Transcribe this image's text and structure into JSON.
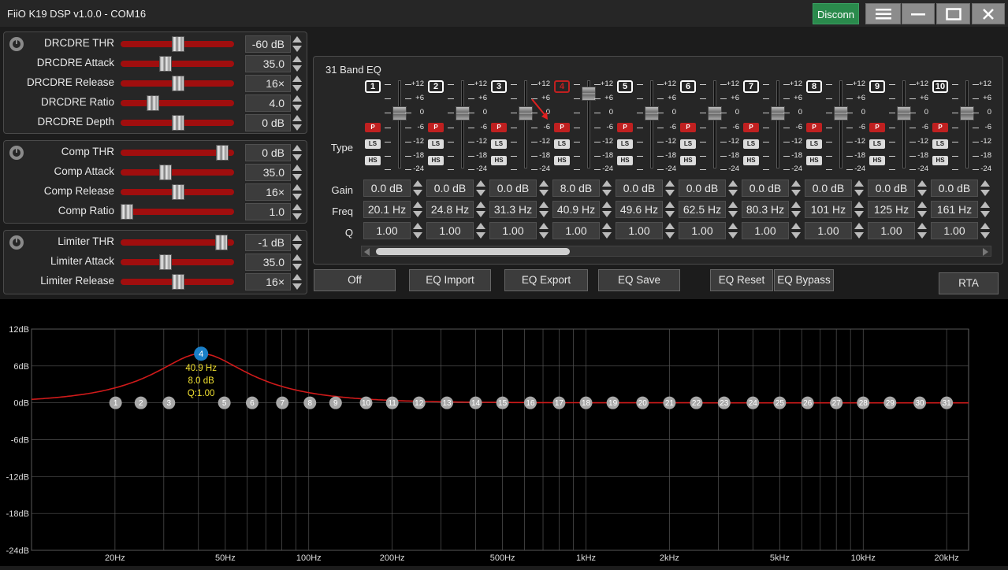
{
  "window": {
    "title": "FiiO K19 DSP v1.0.0 - COM16",
    "disconnect_label": "Disconn",
    "menu_icon": "hamburger-icon",
    "minimize_icon": "minimize-icon",
    "maximize_icon": "maximize-icon",
    "close_icon": "close-icon"
  },
  "drc": {
    "rows": [
      {
        "label": "DRCDRE THR",
        "value": "-60 dB",
        "pos": 0.5
      },
      {
        "label": "DRCDRE Attack",
        "value": "35.0 ms",
        "pos": 0.38
      },
      {
        "label": "DRCDRE Release",
        "value": "16×",
        "pos": 0.5
      },
      {
        "label": "DRCDRE Ratio",
        "value": "4.0",
        "pos": 0.25
      },
      {
        "label": "DRCDRE Depth",
        "value": "0 dB",
        "pos": 0.5
      }
    ]
  },
  "comp": {
    "rows": [
      {
        "label": "Comp THR",
        "value": "0 dB",
        "pos": 0.93
      },
      {
        "label": "Comp Attack",
        "value": "35.0 ms",
        "pos": 0.38
      },
      {
        "label": "Comp Release",
        "value": "16×",
        "pos": 0.5
      },
      {
        "label": "Comp Ratio",
        "value": "1.0",
        "pos": 0.0
      }
    ]
  },
  "limiter": {
    "rows": [
      {
        "label": "Limiter THR",
        "value": "-1 dB",
        "pos": 0.92
      },
      {
        "label": "Limiter Attack",
        "value": "35.0 ms",
        "pos": 0.38
      },
      {
        "label": "Limiter Release",
        "value": "16×",
        "pos": 0.5
      }
    ]
  },
  "eq": {
    "title": "31 Band EQ",
    "type_label": "Type",
    "gain_label": "Gain",
    "freq_label": "Freq",
    "q_label": "Q",
    "scale": [
      "+12",
      "+6",
      "0",
      "-6",
      "-12",
      "-18",
      "-24"
    ],
    "type_buttons": [
      "P",
      "LS",
      "HS"
    ],
    "bands": [
      {
        "num": "1",
        "gain": "0.0 dB",
        "freq": "20.1 Hz",
        "q": "1.00",
        "level": 0
      },
      {
        "num": "2",
        "gain": "0.0 dB",
        "freq": "24.8 Hz",
        "q": "1.00",
        "level": 0
      },
      {
        "num": "3",
        "gain": "0.0 dB",
        "freq": "31.3 Hz",
        "q": "1.00",
        "level": 0
      },
      {
        "num": "4",
        "gain": "8.0 dB",
        "freq": "40.9 Hz",
        "q": "1.00",
        "level": 8
      },
      {
        "num": "5",
        "gain": "0.0 dB",
        "freq": "49.6 Hz",
        "q": "1.00",
        "level": 0
      },
      {
        "num": "6",
        "gain": "0.0 dB",
        "freq": "62.5 Hz",
        "q": "1.00",
        "level": 0
      },
      {
        "num": "7",
        "gain": "0.0 dB",
        "freq": "80.3 Hz",
        "q": "1.00",
        "level": 0
      },
      {
        "num": "8",
        "gain": "0.0 dB",
        "freq": "101 Hz",
        "q": "1.00",
        "level": 0
      },
      {
        "num": "9",
        "gain": "0.0 dB",
        "freq": "125 Hz",
        "q": "1.00",
        "level": 0
      },
      {
        "num": "10",
        "gain": "0.0 dB",
        "freq": "161 Hz",
        "q": "1.00",
        "level": 0
      }
    ],
    "selected_band": "4"
  },
  "actions": {
    "off": "Off",
    "import": "EQ Import",
    "export": "EQ Export",
    "save": "EQ Save",
    "reset": "EQ Reset",
    "bypass": "EQ Bypass",
    "rta": "RTA"
  },
  "chart_data": {
    "type": "line",
    "y_ticks": [
      "12dB",
      "6dB",
      "0dB",
      "-6dB",
      "-12dB",
      "-18dB",
      "-24dB"
    ],
    "ylim": [
      -24,
      12
    ],
    "x_scale": "log",
    "xlim": [
      10,
      24000
    ],
    "x_ticks": [
      {
        "label": "20Hz",
        "value": 20
      },
      {
        "label": "50Hz",
        "value": 50
      },
      {
        "label": "100Hz",
        "value": 100
      },
      {
        "label": "200Hz",
        "value": 200
      },
      {
        "label": "500Hz",
        "value": 500
      },
      {
        "label": "1kHz",
        "value": 1000
      },
      {
        "label": "2kHz",
        "value": 2000
      },
      {
        "label": "5kHz",
        "value": 5000
      },
      {
        "label": "10kHz",
        "value": 10000
      },
      {
        "label": "20kHz",
        "value": 20000
      }
    ],
    "active_band": {
      "num": "4",
      "freq": 40.9,
      "gain": 8.0,
      "q": 1.0,
      "freq_label": "40.9 Hz",
      "gain_label": "8.0 dB",
      "q_label": "Q:1.00"
    },
    "band_markers": [
      {
        "num": "1",
        "freq": 20.1
      },
      {
        "num": "2",
        "freq": 24.8
      },
      {
        "num": "3",
        "freq": 31.3
      },
      {
        "num": "5",
        "freq": 49.6
      },
      {
        "num": "6",
        "freq": 62.5
      },
      {
        "num": "7",
        "freq": 80.3
      },
      {
        "num": "8",
        "freq": 101
      },
      {
        "num": "9",
        "freq": 125
      },
      {
        "num": "10",
        "freq": 161
      },
      {
        "num": "11",
        "freq": 200
      },
      {
        "num": "12",
        "freq": 250
      },
      {
        "num": "13",
        "freq": 315
      },
      {
        "num": "14",
        "freq": 400
      },
      {
        "num": "15",
        "freq": 500
      },
      {
        "num": "16",
        "freq": 630
      },
      {
        "num": "17",
        "freq": 800
      },
      {
        "num": "18",
        "freq": 1000
      },
      {
        "num": "19",
        "freq": 1250
      },
      {
        "num": "20",
        "freq": 1600
      },
      {
        "num": "21",
        "freq": 2000
      },
      {
        "num": "22",
        "freq": 2500
      },
      {
        "num": "23",
        "freq": 3150
      },
      {
        "num": "24",
        "freq": 4000
      },
      {
        "num": "25",
        "freq": 5000
      },
      {
        "num": "26",
        "freq": 6300
      },
      {
        "num": "27",
        "freq": 8000
      },
      {
        "num": "28",
        "freq": 10000
      },
      {
        "num": "29",
        "freq": 12500
      },
      {
        "num": "30",
        "freq": 16000
      },
      {
        "num": "31",
        "freq": 20000
      }
    ],
    "colors": {
      "curve": "#d01a1a",
      "active_marker": "#1a7fc8",
      "marker": "#a8a8a8",
      "annotation": "#f0e030",
      "grid": "#555555"
    }
  }
}
